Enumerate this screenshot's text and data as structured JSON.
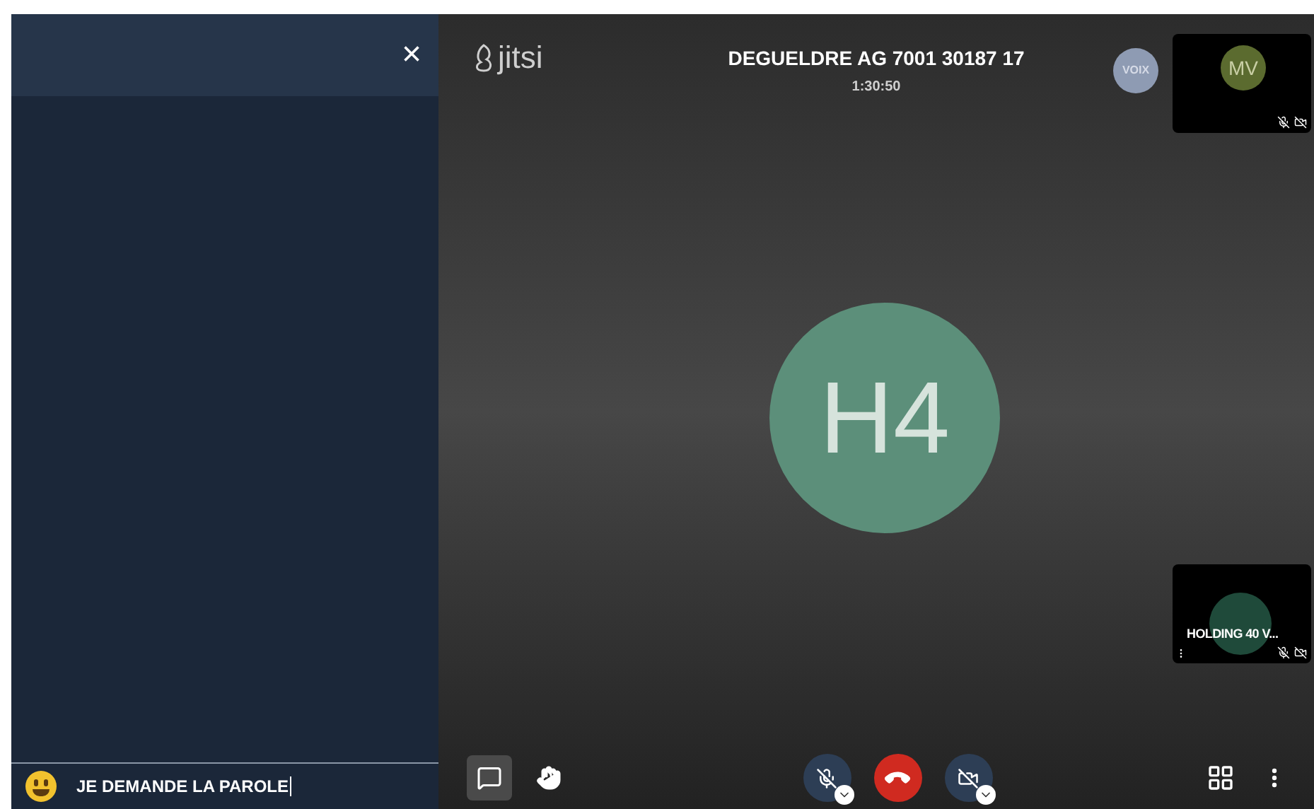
{
  "chat_panel": {
    "close": "×",
    "message_input": {
      "value": "JE DEMANDE LA PAROLE"
    }
  },
  "header": {
    "logo": "jitsi",
    "title": "DEGUELDRE AG 7001 30187 17",
    "timer": "1:30:50"
  },
  "speaker_avatar": {
    "initials": "VOIX",
    "color": "#8e9bb3"
  },
  "large_avatar": {
    "initials": "H4",
    "color": "#5c8f7a"
  },
  "thumbnails": [
    {
      "kind": "avatar",
      "initials": "MV",
      "color": "#5b6b2f",
      "mic_muted": true,
      "camera_muted": true
    },
    {
      "kind": "name",
      "name": "HOLDING 40 V...",
      "color": "#1f4a3a",
      "mic_muted": true,
      "camera_muted": true
    }
  ],
  "toolbar": {
    "chat": {
      "selected": true
    },
    "mic": {
      "muted": true
    },
    "camera": {
      "muted": true
    }
  }
}
